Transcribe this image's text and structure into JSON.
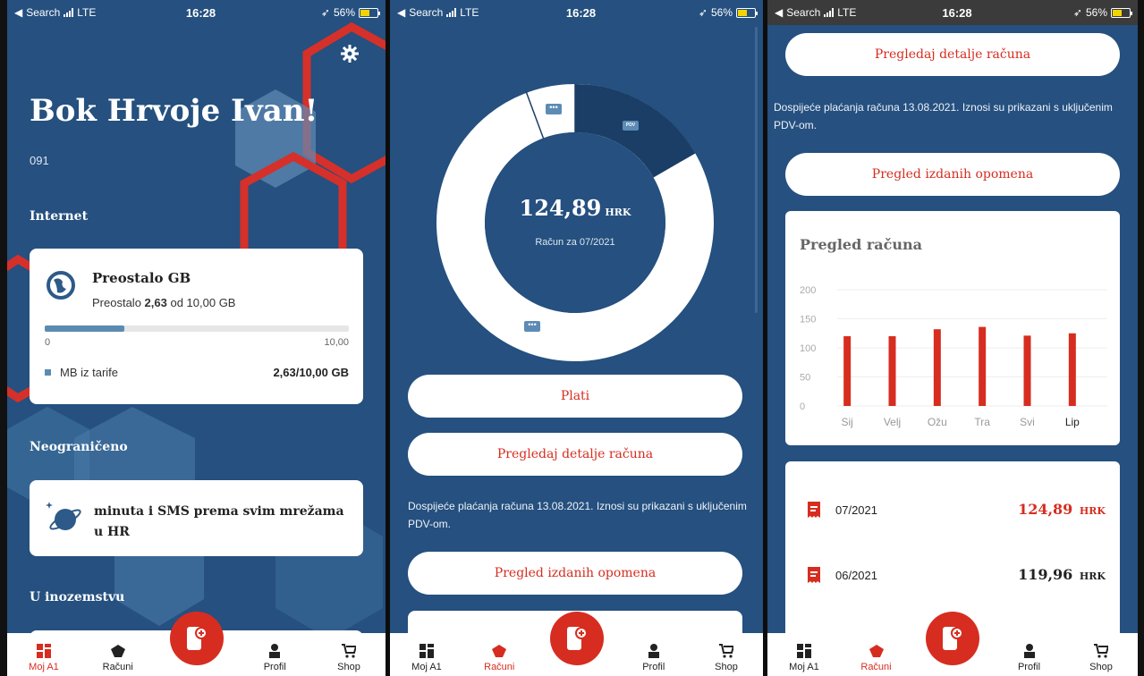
{
  "status": {
    "back": "Search",
    "network": "LTE",
    "time": "16:28",
    "battery": "56%"
  },
  "nav": {
    "items": [
      {
        "label": "Moj A1",
        "icon": "home-grid-icon"
      },
      {
        "label": "Računi",
        "icon": "bills-icon"
      },
      {
        "label": "Profil",
        "icon": "person-icon"
      },
      {
        "label": "Shop",
        "icon": "cart-icon"
      }
    ],
    "fab_icon": "phone-add-icon"
  },
  "screen1": {
    "greeting": "Bok Hrvoje Ivan!",
    "number": "091",
    "internet_heading": "Internet",
    "internet_card": {
      "title": "Preostalo GB",
      "subtitle_prefix": "Preostalo",
      "subtitle_value": "2,63",
      "subtitle_suffix": "od 10,00 GB",
      "progress": 0.263,
      "min": "0",
      "max": "10,00",
      "legend_label": "MB iz tarife",
      "legend_value": "2,63/10,00 GB"
    },
    "unlimited_heading": "Neograničeno",
    "unlimited_card": {
      "title": "minuta i SMS prema svim mrežama u HR"
    },
    "abroad_heading": "U inozemstvu",
    "colors": {
      "background": "#25507f",
      "accent": "#d62d20"
    }
  },
  "screen2": {
    "amount": "124,89",
    "currency": "HRK",
    "period": "Račun za 07/2021",
    "pdv_label": "PDV",
    "pay_button": "Plati",
    "details_button": "Pregledaj detalje računa",
    "note": "Dospijeće plaćanja računa 13.08.2021. Iznosi su prikazani s uključenim PDV-om.",
    "warnings_button": "Pregled izdanih opomena"
  },
  "screen3": {
    "details_button": "Pregledaj detalje računa",
    "note": "Dospijeće plaćanja računa 13.08.2021. Iznosi su prikazani s uključenim PDV-om.",
    "warnings_button": "Pregled izdanih opomena",
    "bills": [
      {
        "period": "07/2021",
        "amount": "124,89",
        "currency": "HRK"
      },
      {
        "period": "06/2021",
        "amount": "119,96",
        "currency": "HRK"
      }
    ]
  },
  "chart_data": {
    "type": "bar",
    "title": "Pregled računa",
    "categories": [
      "Sij",
      "Velj",
      "Ožu",
      "Tra",
      "Svi",
      "Lip"
    ],
    "values": [
      120,
      120,
      132,
      136,
      121,
      125
    ],
    "ylim": [
      0,
      200
    ],
    "yticks": [
      "200",
      "150",
      "100",
      "50",
      "0"
    ],
    "bar_color": "#d62d20",
    "grid": true
  }
}
